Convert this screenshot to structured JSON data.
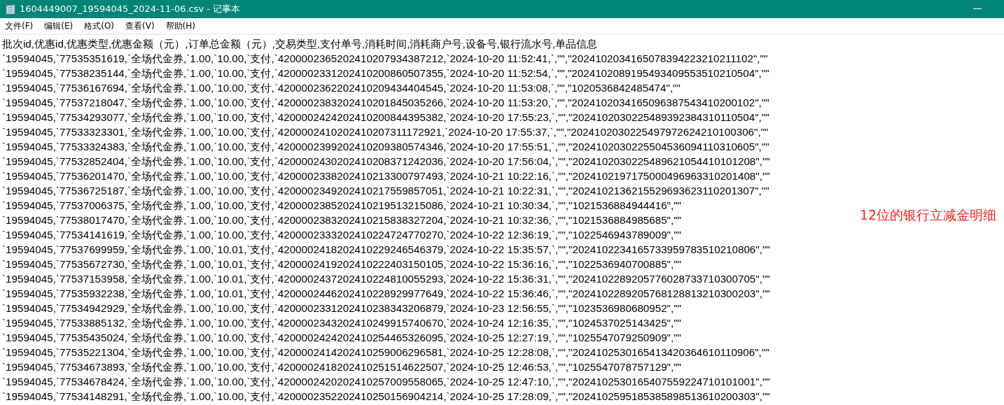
{
  "window": {
    "title": "1604449007_19594045_2024-11-06.csv - 记事本"
  },
  "menu": [
    "文件(F)",
    "编辑(E)",
    "格式(O)",
    "查看(V)",
    "帮助(H)"
  ],
  "lines": [
    "批次id,优惠id,优惠类型,优惠金额（元）,订单总金额（元）,交易类型,支付单号,消耗时间,消耗商户号,设备号,银行流水号,单品信息",
    "`19594045,`77535351619,`全场代金券,`1.00,`10.00,`支付,`4200002365202410207934387212,`2024-10-20 11:52:41,`,\"\",\"2024102034165078394223210211102\",\"\"",
    "`19594045,`77538235144,`全场代金券,`1.00,`10.00,`支付,`4200002331202410200860507355,`2024-10-20 11:52:54,`,\"\",\"2024102089195493409553510210504\",\"\"",
    "`19594045,`77536167694,`全场代金券,`1.00,`10.00,`支付,`4200002362202410209434404545,`2024-10-20 11:53:08,`,\"\",\"1020536842485474\",\"\"",
    "`19594045,`77537218047,`全场代金券,`1.00,`10.00,`支付,`4200002383202410201845035266,`2024-10-20 11:53:20,`,\"\",\"2024102034165096387543410200102\",\"\"",
    "`19594045,`77534293077,`全场代金券,`1.00,`10.00,`支付,`4200002424202410200844395382,`2024-10-20 17:55:23,`,\"\",\"2024102030225489392384310110504\",\"\"",
    "`19594045,`77533323301,`全场代金券,`1.00,`10.00,`支付,`4200002410202410207311172921,`2024-10-20 17:55:37,`,\"\",\"2024102030225497972624210100306\",\"\"",
    "`19594045,`77533324383,`全场代金券,`1.00,`10.00,`支付,`4200002399202410209380574346,`2024-10-20 17:55:51,`,\"\",\"2024102030225504536094110310605\",\"\"",
    "`19594045,`77532852404,`全场代金券,`1.00,`10.00,`支付,`4200002430202410208371242036,`2024-10-20 17:56:04,`,\"\",\"2024102030225489621054410101208\",\"\"",
    "`19594045,`77536201470,`全场代金券,`1.00,`10.00,`支付,`4200002338202410213300797493,`2024-10-21 10:22:16,`,\"\",\"2024102197175000496963310201408\",\"\"",
    "`19594045,`77536725187,`全场代金券,`1.00,`10.00,`支付,`4200002349202410217559857051,`2024-10-21 10:22:31,`,\"\",\"2024102136215529693623110201307\",\"\"",
    "`19594045,`77537006375,`全场代金券,`1.00,`10.00,`支付,`4200002385202410219513215086,`2024-10-21 10:30:34,`,\"\",\"1021536884944416\",\"\"",
    "`19594045,`77538017470,`全场代金券,`1.00,`10.00,`支付,`4200002383202410215838327204,`2024-10-21 10:32:36,`,\"\",\"1021536884985685\",\"\"",
    "`19594045,`77534141619,`全场代金券,`1.00,`10.00,`支付,`4200002333202410224724770270,`2024-10-22 12:36:19,`,\"\",\"1022546943789009\",\"\"",
    "`19594045,`77537699959,`全场代金券,`1.00,`10.01,`支付,`4200002418202410229246546379,`2024-10-22 15:35:57,`,\"\",\"2024102234165733959783510210806\",\"\"",
    "`19594045,`77535672730,`全场代金券,`1.00,`10.01,`支付,`4200002419202410222403150105,`2024-10-22 15:36:16,`,\"\",\"1022536940700885\",\"\"",
    "`19594045,`77537153958,`全场代金券,`1.00,`10.01,`支付,`4200002437202410224810055293,`2024-10-22 15:36:31,`,\"\",\"2024102289205776028733710300705\",\"\"",
    "`19594045,`77535932238,`全场代金券,`1.00,`10.01,`支付,`4200002446202410228929977649,`2024-10-22 15:36:46,`,\"\",\"2024102289205768128813210300203\",\"\"",
    "`19594045,`77534942929,`全场代金券,`1.00,`10.00,`支付,`4200002331202410238343206879,`2024-10-23 12:56:55,`,\"\",\"1023536980680952\",\"\"",
    "`19594045,`77533885132,`全场代金券,`1.00,`10.00,`支付,`4200002343202410249915740670,`2024-10-24 12:16:35,`,\"\",\"1024537025143425\",\"\"",
    "`19594045,`77535435024,`全场代金券,`1.00,`10.00,`支付,`4200002424202410254465326095,`2024-10-25 12:27:19,`,\"\",\"1025547079250909\",\"\"",
    "`19594045,`77535221304,`全场代金券,`1.00,`10.00,`支付,`4200002414202410259006296581,`2024-10-25 12:28:08,`,\"\",\"2024102530165413420364610110906\",\"\"",
    "`19594045,`77534673893,`全场代金券,`1.00,`10.00,`支付,`4200002418202410251514622507,`2024-10-25 12:46:53,`,\"\",\"1025547078757129\",\"\"",
    "`19594045,`77534678424,`全场代金券,`1.00,`10.00,`支付,`4200002420202410257009558065,`2024-10-25 12:47:10,`,\"\",\"2024102530165407559224710101001\",\"\"",
    "`19594045,`77534148291,`全场代金券,`1.00,`10.00,`支付,`4200002352202410250156904214,`2024-10-25 17:28:09,`,\"\",\"2024102595185385898513610200303\",\"\""
  ],
  "annotation": "12位的银行立减金明细"
}
